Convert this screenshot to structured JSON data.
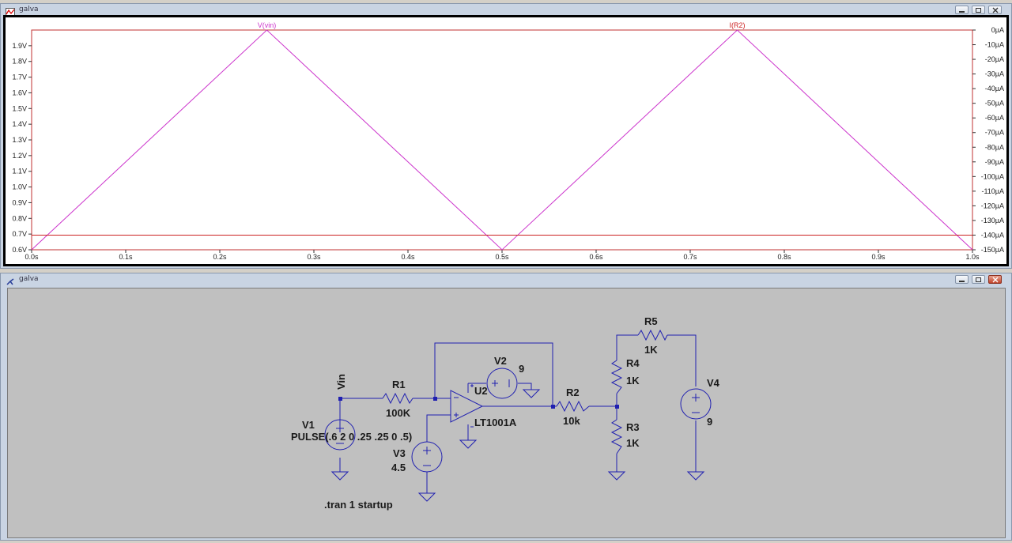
{
  "plot_window": {
    "title": "galva",
    "controls": [
      "minimize",
      "restore",
      "close"
    ]
  },
  "schematic_window": {
    "title": "galva",
    "controls": [
      "minimize",
      "restore",
      "close"
    ]
  },
  "chart_data": {
    "type": "line",
    "title": "",
    "xlabel": "",
    "ylabel": "",
    "xlim": [
      0,
      1.0
    ],
    "ylim_left": [
      0.6,
      2.0
    ],
    "ylim_right": [
      -150,
      0
    ],
    "grid": false,
    "x_ticks": [
      "0.0s",
      "0.1s",
      "0.2s",
      "0.3s",
      "0.4s",
      "0.5s",
      "0.6s",
      "0.7s",
      "0.8s",
      "0.9s",
      "1.0s"
    ],
    "y_left_ticks": [
      "0.6V",
      "0.7V",
      "0.8V",
      "0.9V",
      "1.0V",
      "1.1V",
      "1.2V",
      "1.3V",
      "1.4V",
      "1.5V",
      "1.6V",
      "1.7V",
      "1.8V",
      "1.9V"
    ],
    "y_right_ticks": [
      "0µA",
      "-10µA",
      "-20µA",
      "-30µA",
      "-40µA",
      "-50µA",
      "-60µA",
      "-70µA",
      "-80µA",
      "-90µA",
      "-100µA",
      "-110µA",
      "-120µA",
      "-130µA",
      "-140µA",
      "-150µA"
    ],
    "series": [
      {
        "name": "V(vin)",
        "axis": "left",
        "color": "#cc33cc",
        "x": [
          0.0,
          0.25,
          0.5,
          0.75,
          1.0
        ],
        "y": [
          0.6,
          2.0,
          0.6,
          2.0,
          0.6
        ]
      },
      {
        "name": "I(R2)",
        "axis": "right",
        "color": "#cc2222",
        "x": [
          0.0,
          1.0
        ],
        "y": [
          -140,
          -140
        ]
      }
    ]
  },
  "schematic": {
    "wire_color": "#2020b0",
    "symbol_color": "#3030c0",
    "labels": {
      "net_vin": "Vin",
      "r1_name": "R1",
      "r1_value": "100K",
      "v1_name": "V1",
      "v1_value": "PULSE(.6 2 0 .25 .25 0 .5)",
      "v2_name": "V2",
      "v2_value": "9",
      "v3_name": "V3",
      "v3_value": "4.5",
      "u2_name": "U2",
      "u2_value": "LT1001A",
      "r2_name": "R2",
      "r2_value": "10k",
      "r3_name": "R3",
      "r3_value": "1K",
      "r4_name": "R4",
      "r4_value": "1K",
      "r5_name": "R5",
      "r5_value": "1K",
      "v4_name": "V4",
      "v4_value": "9",
      "directive": ".tran 1 startup"
    }
  }
}
